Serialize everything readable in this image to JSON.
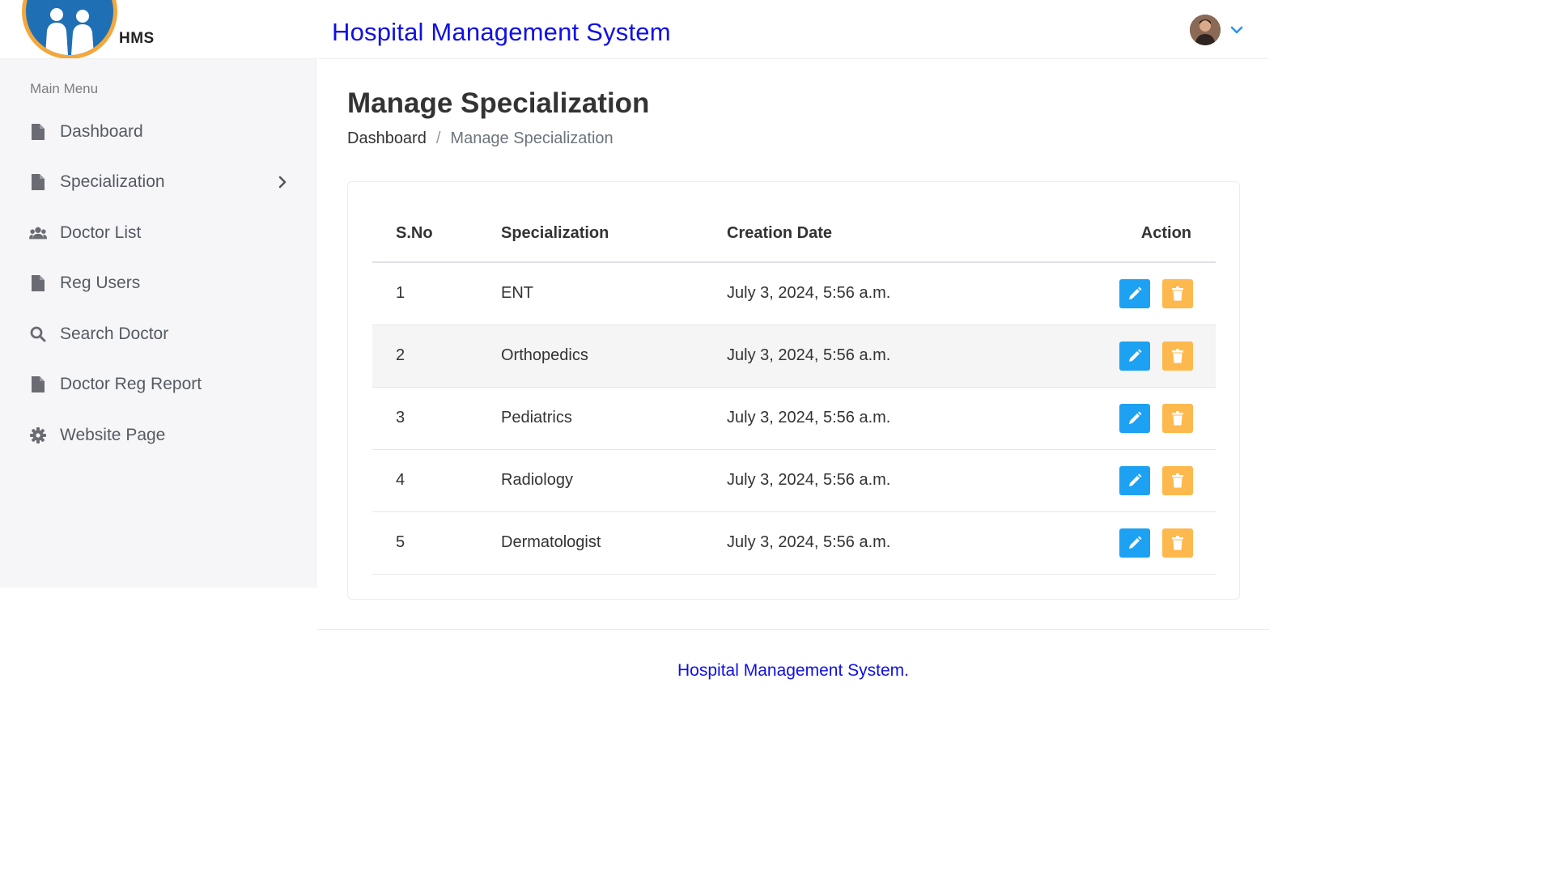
{
  "brand": {
    "logo_text": "HMS",
    "app_title": "Hospital Management System"
  },
  "sidebar": {
    "menu_title": "Main Menu",
    "items": [
      {
        "label": "Dashboard",
        "icon": "file-icon"
      },
      {
        "label": "Specialization",
        "icon": "file-icon",
        "has_submenu": true
      },
      {
        "label": "Doctor List",
        "icon": "users-icon"
      },
      {
        "label": "Reg Users",
        "icon": "file-icon"
      },
      {
        "label": "Search Doctor",
        "icon": "search-icon"
      },
      {
        "label": "Doctor Reg Report",
        "icon": "file-icon"
      },
      {
        "label": "Website Page",
        "icon": "gear-icon"
      }
    ]
  },
  "page": {
    "title": "Manage Specialization",
    "breadcrumb": {
      "home": "Dashboard",
      "separator": "/",
      "current": "Manage Specialization"
    }
  },
  "table": {
    "headers": {
      "sno": "S.No",
      "specialization": "Specialization",
      "creation_date": "Creation Date",
      "action": "Action"
    },
    "rows": [
      {
        "sno": "1",
        "specialization": "ENT",
        "creation_date": "July 3, 2024, 5:56 a.m."
      },
      {
        "sno": "2",
        "specialization": "Orthopedics",
        "creation_date": "July 3, 2024, 5:56 a.m."
      },
      {
        "sno": "3",
        "specialization": "Pediatrics",
        "creation_date": "July 3, 2024, 5:56 a.m."
      },
      {
        "sno": "4",
        "specialization": "Radiology",
        "creation_date": "July 3, 2024, 5:56 a.m."
      },
      {
        "sno": "5",
        "specialization": "Dermatologist",
        "creation_date": "July 3, 2024, 5:56 a.m."
      }
    ]
  },
  "footer": {
    "text": "Hospital Management System."
  },
  "colors": {
    "title_blue": "#1010e6",
    "edit_button": "#1da1f2",
    "delete_button": "#fdb94d",
    "logo_ring": "#f4a73b",
    "logo_fill": "#1f6fb5"
  }
}
